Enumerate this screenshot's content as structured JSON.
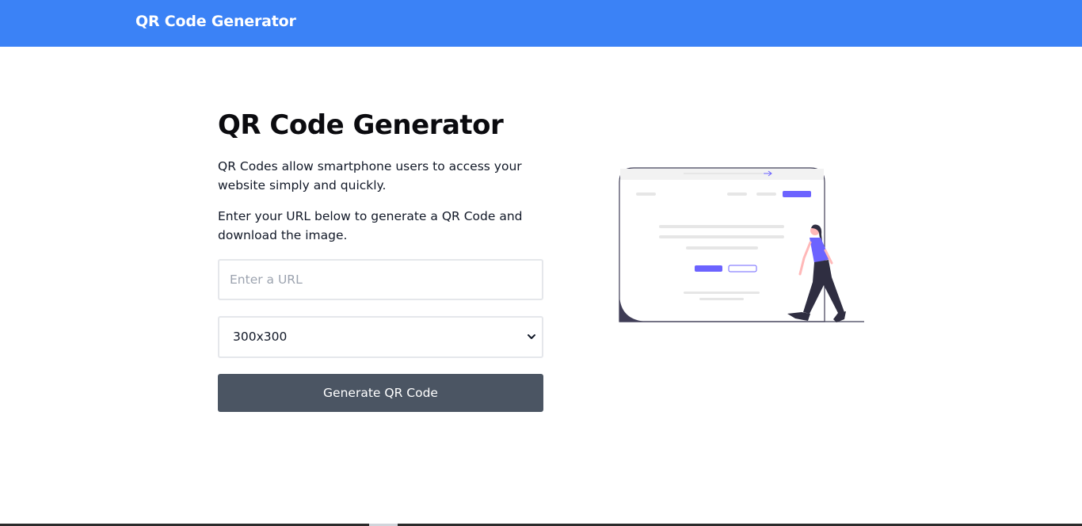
{
  "header": {
    "brand": "QR Code Generator"
  },
  "main": {
    "title": "QR Code Generator",
    "description_1": "QR Codes allow smartphone users to access your website simply and quickly.",
    "description_2": "Enter your URL below to generate a QR Code and download the image.",
    "url_input": {
      "placeholder": "Enter a URL",
      "value": ""
    },
    "size_select": {
      "selected": "300x300"
    },
    "generate_button": "Generate QR Code"
  },
  "colors": {
    "header_bg": "#3b82f6",
    "button_bg": "#4b5563",
    "illustration_accent": "#6c63ff"
  },
  "icons": {
    "select_chevron": "chevron-down-icon",
    "illustration": "walking-woman-browser-illustration"
  }
}
